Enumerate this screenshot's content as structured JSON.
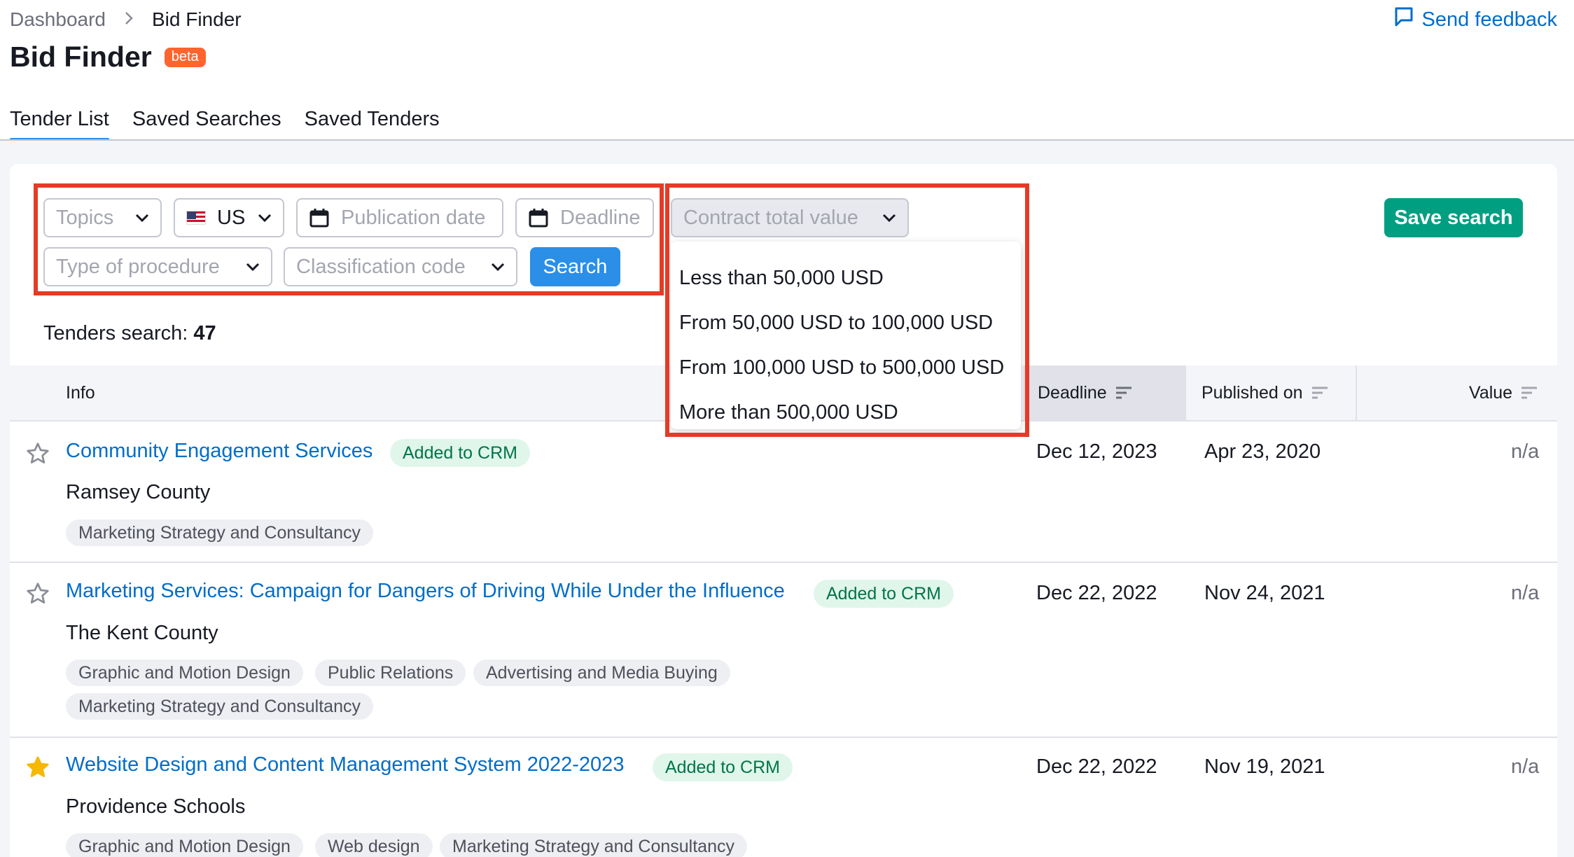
{
  "breadcrumb": {
    "parent": "Dashboard",
    "current": "Bid Finder"
  },
  "feedback": {
    "label": "Send feedback"
  },
  "page": {
    "title": "Bid Finder",
    "badge": "beta"
  },
  "tabs": [
    {
      "label": "Tender List",
      "active": true
    },
    {
      "label": "Saved Searches",
      "active": false
    },
    {
      "label": "Saved Tenders",
      "active": false
    }
  ],
  "filters": {
    "topics_placeholder": "Topics",
    "country_value": "US",
    "publication_date_placeholder": "Publication date",
    "deadline_placeholder": "Deadline",
    "procedure_placeholder": "Type of procedure",
    "classification_placeholder": "Classification code",
    "contract_value_placeholder": "Contract total value",
    "search_label": "Search",
    "save_search_label": "Save search"
  },
  "contract_value_options": [
    "Less than 50,000 USD",
    "From 50,000 USD to 100,000 USD",
    "From 100,000 USD to 500,000 USD",
    "More than 500,000 USD"
  ],
  "results": {
    "label": "Tenders search: ",
    "count": "47"
  },
  "table": {
    "headers": {
      "info": "Info",
      "deadline": "Deadline",
      "published": "Published on",
      "value": "Value"
    },
    "rows": [
      {
        "title": "Community Engagement Services",
        "badge": "Added to CRM",
        "buyer": "Ramsey County",
        "tags": [
          "Marketing Strategy and Consultancy"
        ],
        "deadline": "Dec 12, 2023",
        "published": "Apr 23, 2020",
        "value": "n/a",
        "starred": false
      },
      {
        "title": "Marketing Services: Campaign for Dangers of Driving While Under the Influence",
        "badge": "Added to CRM",
        "buyer": "The Kent County",
        "tags": [
          "Graphic and Motion Design",
          "Public Relations",
          "Advertising and Media Buying",
          "Marketing Strategy and Consultancy"
        ],
        "deadline": "Dec 22, 2022",
        "published": "Nov 24, 2021",
        "value": "n/a",
        "starred": false
      },
      {
        "title": "Website Design and Content Management System 2022-2023",
        "badge": "Added to CRM",
        "buyer": "Providence Schools",
        "tags": [
          "Graphic and Motion Design",
          "Web design",
          "Marketing Strategy and Consultancy"
        ],
        "deadline": "Dec 22, 2022",
        "published": "Nov 19, 2021",
        "value": "n/a",
        "starred": true
      }
    ]
  },
  "colors": {
    "link": "#006dca",
    "search_button": "#2b8fe8",
    "save_button": "#009f81",
    "highlight_box": "#e53b26",
    "crm_badge_bg": "#e0f6ea",
    "beta_badge": "#ff642d",
    "star_filled": "#f6b800"
  },
  "icons": [
    "chevron-right-icon",
    "feedback-icon",
    "chevron-down-icon",
    "us-flag-icon",
    "calendar-icon",
    "sort-icon",
    "star-icon"
  ]
}
